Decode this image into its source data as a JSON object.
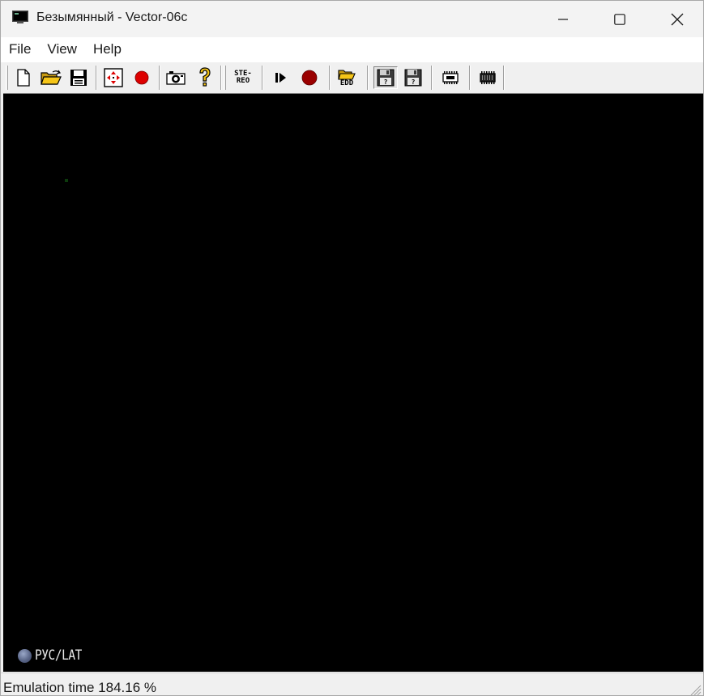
{
  "window": {
    "title": "Безымянный - Vector-06c"
  },
  "menu": {
    "items": [
      "File",
      "View",
      "Help"
    ]
  },
  "toolbar": {
    "buttons": [
      {
        "icon": "new-file-icon"
      },
      {
        "icon": "open-folder-icon"
      },
      {
        "icon": "save-disk-icon"
      },
      {
        "icon": "fullscreen-arrows-icon"
      },
      {
        "icon": "record-red-icon"
      },
      {
        "icon": "camera-icon"
      },
      {
        "icon": "help-question-icon"
      },
      {
        "icon": "stereo-icon",
        "label_top": "STE-",
        "label_bottom": "REO"
      },
      {
        "icon": "play-step-icon"
      },
      {
        "icon": "stop-record-icon"
      },
      {
        "icon": "open-edd-icon",
        "label": "EDD"
      },
      {
        "icon": "floppy-a-icon",
        "pressed": true
      },
      {
        "icon": "floppy-b-icon"
      },
      {
        "icon": "ram-chip-icon"
      },
      {
        "icon": "rom-chip-icon"
      }
    ]
  },
  "screen": {
    "background": "#000000",
    "indicator": {
      "label": "РУС/LAT"
    }
  },
  "status": {
    "text": "Emulation time 184.16 %"
  },
  "colors": {
    "record_red": "#dd0000",
    "stop_red": "#9a0000",
    "folder_yellow": "#f5c518"
  }
}
